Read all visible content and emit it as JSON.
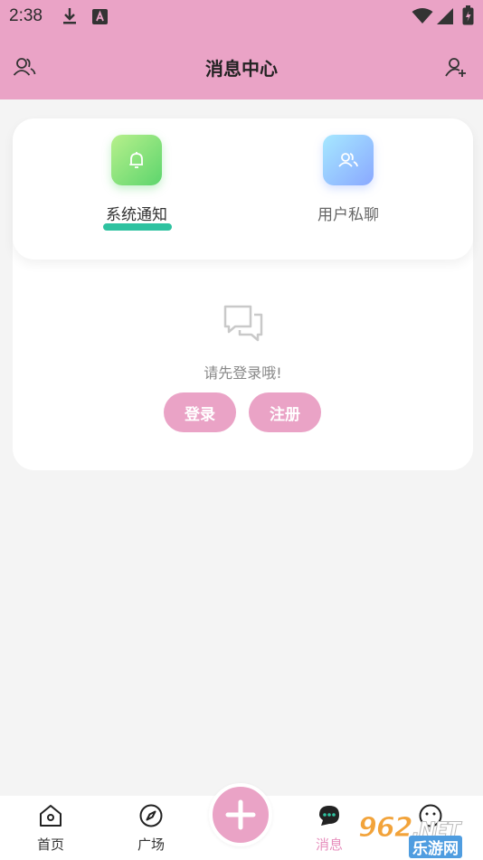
{
  "status_bar": {
    "time": "2:38"
  },
  "header": {
    "title": "消息中心"
  },
  "tabs": [
    {
      "label": "系统通知",
      "active": true
    },
    {
      "label": "用户私聊",
      "active": false
    }
  ],
  "empty_state": {
    "message": "请先登录哦!"
  },
  "buttons": {
    "login": "登录",
    "register": "注册"
  },
  "bottom_nav": [
    {
      "label": "首页",
      "icon": "home-icon"
    },
    {
      "label": "广场",
      "icon": "compass-icon"
    },
    {
      "label": "消息",
      "icon": "chat-icon",
      "active": true
    },
    {
      "label": "",
      "icon": "more-icon"
    }
  ],
  "watermark": {
    "main": "962",
    "suffix": ".NET",
    "sub": "乐游网"
  },
  "colors": {
    "brand_pink": "#eaa3c6",
    "accent_green": "#2ec2a0"
  }
}
